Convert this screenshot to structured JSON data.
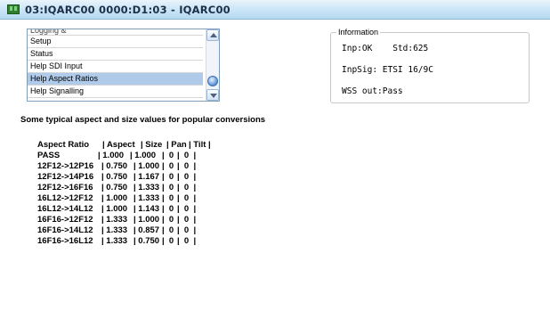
{
  "window": {
    "title": "03:IQARC00  0000:D1:03  - IQARC00"
  },
  "nav_list": {
    "items": [
      {
        "label": "Logging &",
        "state": "partially-hidden"
      },
      {
        "label": "Setup"
      },
      {
        "label": "Status"
      },
      {
        "label": "Help SDI Input"
      },
      {
        "label": "Help Aspect Ratios",
        "selected": true
      },
      {
        "label": "Help Signalling"
      }
    ]
  },
  "information": {
    "legend": "Information",
    "inp": "Inp:OK    Std:625",
    "inpsig": "InpSig: ETSI 16/9C",
    "wss": "WSS out:Pass"
  },
  "help": {
    "description": "Some typical aspect and size values for popular conversions"
  },
  "aspect_table": {
    "header": {
      "aspect_ratio": "Aspect Ratio",
      "aspect": "| Aspect",
      "size": "| Size",
      "pan": "| Pan",
      "tilt": "| Tilt |"
    },
    "rows": [
      {
        "ratio": "PASS",
        "aspect": "| 1.000",
        "size": "| 1.000",
        "pan": "|  0",
        "tilt": "|  0  |"
      },
      {
        "ratio": "12F12->12P16",
        "aspect": "| 0.750",
        "size": "| 1.000",
        "pan": "|  0",
        "tilt": "|  0  |"
      },
      {
        "ratio": "12F12->14P16",
        "aspect": "| 0.750",
        "size": "| 1.167",
        "pan": "|  0",
        "tilt": "|  0  |"
      },
      {
        "ratio": "12F12->16F16",
        "aspect": "| 0.750",
        "size": "| 1.333",
        "pan": "|  0",
        "tilt": "|  0  |"
      },
      {
        "ratio": "16L12->12F12",
        "aspect": "| 1.000",
        "size": "| 1.333",
        "pan": "|  0",
        "tilt": "|  0  |"
      },
      {
        "ratio": "16L12->14L12",
        "aspect": "| 1.000",
        "size": "| 1.143",
        "pan": "|  0",
        "tilt": "|  0  |"
      },
      {
        "ratio": "16F16->12F12",
        "aspect": "| 1.333",
        "size": "| 1.000",
        "pan": "|  0",
        "tilt": "|  0  |"
      },
      {
        "ratio": "16F16->14L12",
        "aspect": "| 1.333",
        "size": "| 0.857",
        "pan": "|  0",
        "tilt": "|  0  |"
      },
      {
        "ratio": "16F16->16L12",
        "aspect": "| 1.333",
        "size": "| 0.750",
        "pan": "|  0",
        "tilt": "|  0  |"
      }
    ]
  },
  "colors": {
    "selection": "#b0cbea",
    "title_text": "#1d2f49"
  }
}
